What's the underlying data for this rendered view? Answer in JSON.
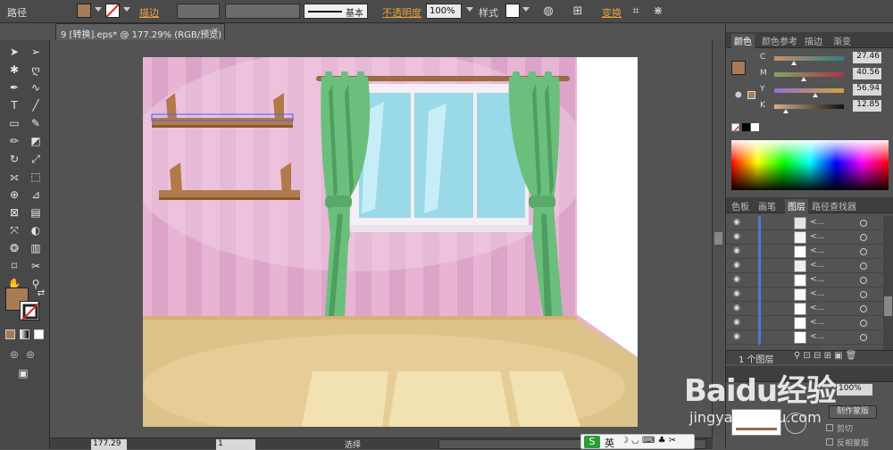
{
  "control_bar": {
    "mode_label": "路径",
    "stroke_label": "描边",
    "brush_label": "基本",
    "opacity_label": "不透明度",
    "opacity_value": "100%",
    "style_label": "样式",
    "transform_label": "变换"
  },
  "document_tab": {
    "title": "9 [转换].eps* @ 177.29% (RGB/预览)",
    "close": "×"
  },
  "color_panel": {
    "tabs": [
      "颜色",
      "颜色参考",
      "描边",
      "渐变"
    ],
    "sliders": [
      {
        "label": "C",
        "value": "27.46",
        "fraction": 0.2746
      },
      {
        "label": "M",
        "value": "40.56",
        "fraction": 0.4056
      },
      {
        "label": "Y",
        "value": "56.94",
        "fraction": 0.5694
      },
      {
        "label": "K",
        "value": "12.85",
        "fraction": 0.1285
      }
    ]
  },
  "layers_panel": {
    "tabs": [
      "色板",
      "画笔",
      "图层",
      "路径查找器"
    ],
    "rows": [
      {
        "name": "<...",
        "thumb_color": "#e8dff0"
      },
      {
        "name": "<...",
        "thumb_color": "#f3f3f3"
      },
      {
        "name": "<...",
        "thumb_color": "#ffffff"
      },
      {
        "name": "<...",
        "thumb_color": "#eeeeee"
      },
      {
        "name": "<...",
        "thumb_color": "#ffffff"
      },
      {
        "name": "<...",
        "thumb_color": "#fafafa"
      },
      {
        "name": "<...",
        "thumb_color": "#ffffff"
      },
      {
        "name": "<...",
        "thumb_color": "#ffffff"
      },
      {
        "name": "<...",
        "thumb_color": "#ffffff"
      }
    ],
    "footer_label": "1 个图层"
  },
  "transparency_panel": {
    "opacity_value": "100%",
    "make_mask_label": "制作蒙版",
    "clip_label": "剪切",
    "invert_label": "反相蒙版"
  },
  "status_bar": {
    "zoom": "177.29",
    "page": "1",
    "tool_status": "选择"
  },
  "ime": {
    "lang_label": "英"
  },
  "watermark": {
    "brand": "Baidu经验",
    "url": "jingyan.baidu.com"
  },
  "colors": {
    "fill": "#a87b57",
    "wall_pink": "#e7b5d3",
    "stripe_pink": "#d99dc4",
    "floor": "#dcc38a",
    "curtain_green": "#6bbf7c",
    "window_blue": "#8fd6e6",
    "shelf_brown": "#b07a4a",
    "accent_orange": "#e8a23a"
  },
  "icons": {
    "tools": [
      "selection-icon",
      "direct-selection-icon",
      "magic-wand-icon",
      "lasso-icon",
      "pen-icon",
      "curvature-icon",
      "type-icon",
      "line-icon",
      "rectangle-icon",
      "paintbrush-icon",
      "pencil-icon",
      "eraser-icon",
      "rotate-icon",
      "scale-icon",
      "width-icon",
      "free-transform-icon",
      "shape-builder-icon",
      "perspective-icon",
      "mesh-icon",
      "gradient-icon",
      "eyedropper-icon",
      "blend-icon",
      "symbol-sprayer-icon",
      "column-graph-icon",
      "artboard-icon",
      "slice-icon",
      "hand-icon",
      "zoom-icon"
    ]
  }
}
